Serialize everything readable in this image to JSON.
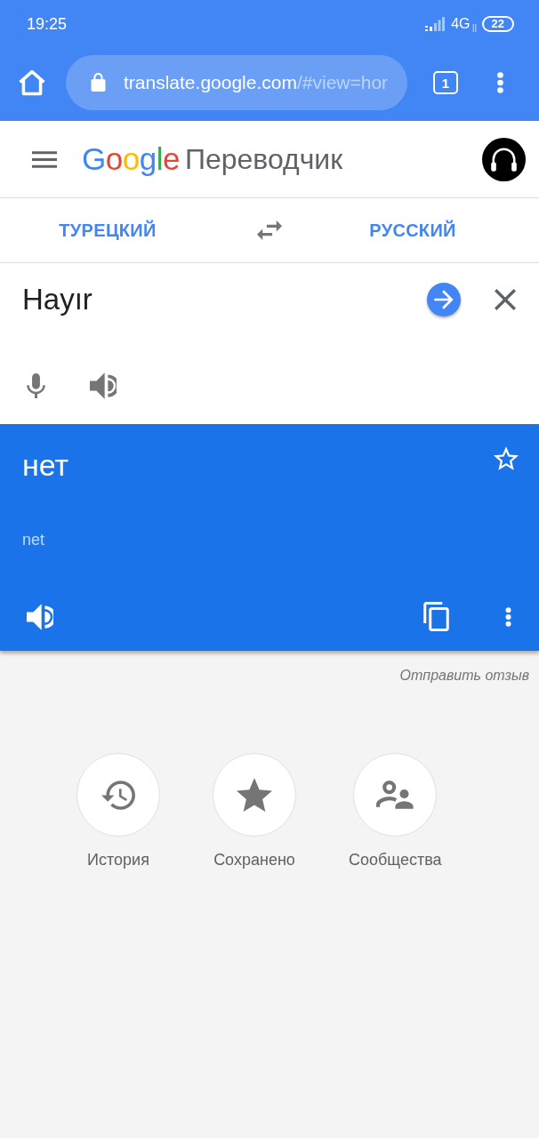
{
  "status_bar": {
    "time": "19:25",
    "network": "4G",
    "battery": "22"
  },
  "browser": {
    "url_host": "translate.google.com",
    "url_path": "/#view=hor",
    "tab_count": "1"
  },
  "app_bar": {
    "logo": "Google",
    "title": "Переводчик"
  },
  "languages": {
    "source": "ТУРЕЦКИЙ",
    "target": "РУССКИЙ"
  },
  "input": {
    "text": "Hayır"
  },
  "translation": {
    "text": "нет",
    "transliteration": "net",
    "saved": false
  },
  "feedback_link": "Отправить отзыв",
  "shortcuts": [
    {
      "kind": "history",
      "label": "История"
    },
    {
      "kind": "saved",
      "label": "Сохранено"
    },
    {
      "kind": "community",
      "label": "Сообщества"
    }
  ]
}
